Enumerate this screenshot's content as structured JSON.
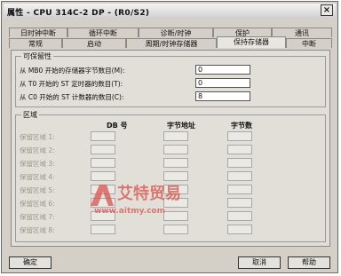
{
  "window": {
    "title": "属性 - CPU 314C-2 DP - (R0/S2)",
    "close": "×"
  },
  "tabs_row1": [
    "日时钟中断",
    "循环中断",
    "诊断/时钟",
    "保护",
    "通讯"
  ],
  "tabs_row2": [
    "常规",
    "启动",
    "周期/时钟存储器",
    "保持存储器",
    "中断"
  ],
  "active_tab": "保持存储器",
  "retentivity": {
    "title": "可保留性",
    "mb_label": "从 MB0 开始的存储器字节数目(M):",
    "mb_value": "0",
    "t_label": "从 T0 开始的 ST 定时器的数目(T):",
    "t_value": "0",
    "c_label": "从 C0 开始的 ST 计数器的数目(C):",
    "c_value": "8"
  },
  "areas": {
    "title": "区域",
    "col_db": "DB 号",
    "col_addr": "字节地址",
    "col_count": "字节数",
    "rows": [
      {
        "label": "保留区域 1:",
        "db": "",
        "addr": "",
        "count": ""
      },
      {
        "label": "保留区域 2:",
        "db": "",
        "addr": "",
        "count": ""
      },
      {
        "label": "保留区域 3:",
        "db": "",
        "addr": "",
        "count": ""
      },
      {
        "label": "保留区域 4:",
        "db": "",
        "addr": "",
        "count": ""
      },
      {
        "label": "保留区域 5:",
        "db": "",
        "addr": "",
        "count": ""
      },
      {
        "label": "保留区域 6:",
        "db": "",
        "addr": "",
        "count": ""
      },
      {
        "label": "保留区域 7:",
        "db": "",
        "addr": "",
        "count": ""
      },
      {
        "label": "保留区域 8:",
        "db": "",
        "addr": "",
        "count": ""
      }
    ]
  },
  "buttons": {
    "ok": "确定",
    "cancel": "取消",
    "help": "帮助"
  },
  "watermark": {
    "name": "艾特贸易",
    "url": "www.aitmy.com",
    "color": "#d9534f"
  }
}
